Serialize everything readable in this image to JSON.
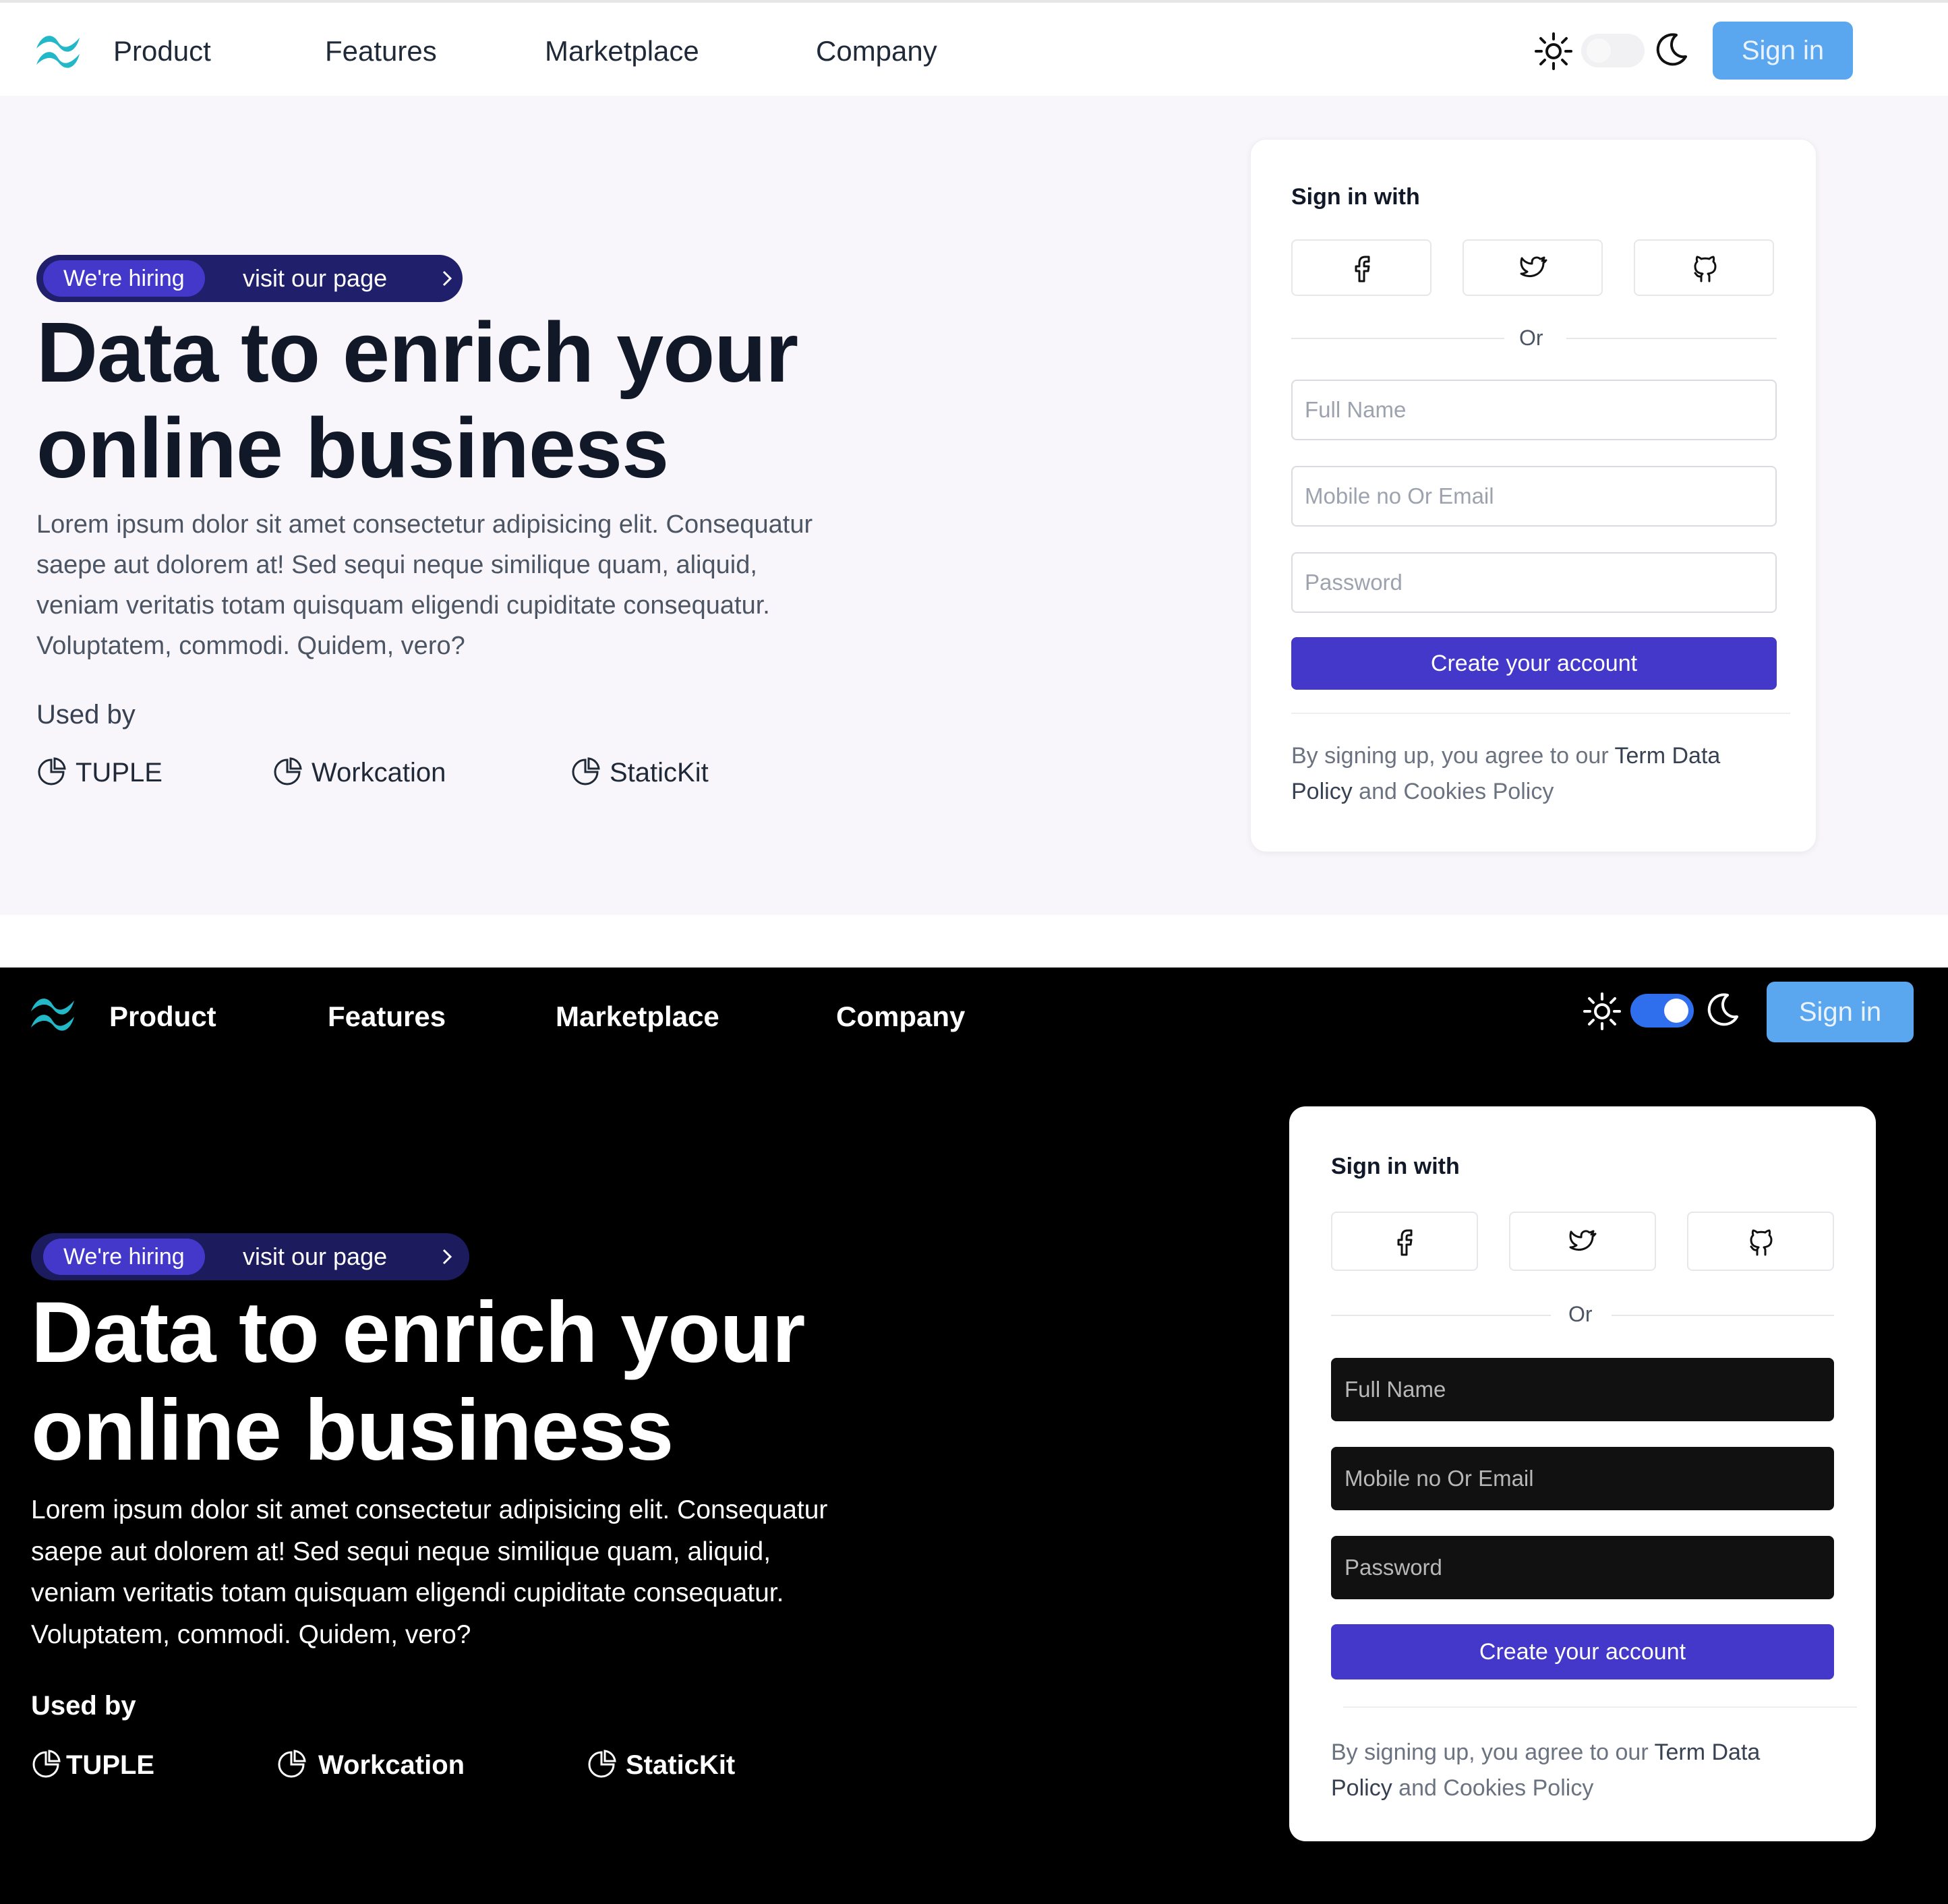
{
  "nav": {
    "links": [
      "Product",
      "Features",
      "Marketplace",
      "Company"
    ],
    "signin_label": "Sign in",
    "icons": [
      "tailwind-logo-icon",
      "sun-icon",
      "moon-icon"
    ]
  },
  "hero": {
    "hiring_tag": "We're hiring",
    "hiring_link": "visit our page",
    "headline_line1": "Data to enrich your",
    "headline_line2": "online business",
    "paragraph_lines": [
      "Lorem ipsum dolor sit amet consectetur adipisicing elit. Consequatur",
      "saepe aut dolorem at! Sed sequi neque similique quam, aliquid,",
      "veniam veritatis totam quisquam eligendi cupiditate consequatur.",
      "Voluptatem, commodi. Quidem, vero?"
    ],
    "used_by_label": "Used by",
    "brands": [
      "TUPLE",
      "Workcation",
      "StaticKit"
    ]
  },
  "card": {
    "title": "Sign in with",
    "social_icons": [
      "facebook-icon",
      "twitter-icon",
      "github-icon"
    ],
    "or_label": "Or",
    "full_name_placeholder": "Full Name",
    "contact_placeholder": "Mobile no Or Email",
    "password_placeholder": "Password",
    "create_label": "Create your account",
    "terms_prefix": "By signing up, you agree to our",
    "terms_link1": "Term Data",
    "terms_link1b": "Policy",
    "terms_and": "and",
    "terms_link2": "Cookies Policy"
  },
  "theme": {
    "light_background": "#f9f6fb",
    "dark_background": "#000000",
    "accent": "#4338ca",
    "signin_button": "#5aa7f0",
    "toggle_on": "#2f6fed",
    "logo_teal": "#22b8c7"
  },
  "states": {
    "top_panel_toggle_dark": false,
    "bottom_panel_toggle_dark": true
  }
}
